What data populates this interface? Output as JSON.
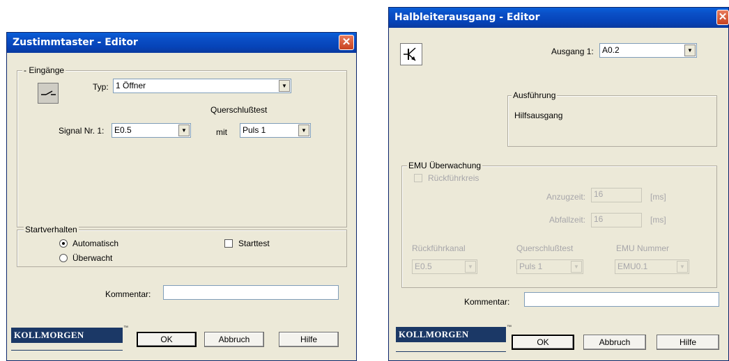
{
  "left_dialog": {
    "title": "Zustimmtaster - Editor",
    "close_glyph": "✕",
    "inputs_group": {
      "legend": "- Eingänge",
      "typ_label": "Typ:",
      "typ_value": "1 Öffner",
      "crossfault_label": "Querschlußtest",
      "signal_label": "Signal Nr. 1:",
      "signal_value": "E0.5",
      "mit_label": "mit",
      "puls_value": "Puls 1"
    },
    "start_group": {
      "legend": "Startverhalten",
      "radio_auto": "Automatisch",
      "radio_monitored": "Überwacht",
      "check_starttest": "Starttest"
    },
    "comment_label": "Kommentar:",
    "comment_value": "",
    "logo": "KOLLMORGEN",
    "buttons": {
      "ok": "OK",
      "cancel": "Abbruch",
      "help": "Hilfe"
    }
  },
  "right_dialog": {
    "title": "Halbleiterausgang - Editor",
    "close_glyph": "✕",
    "output_label": "Ausgang 1:",
    "output_value": "A0.2",
    "exec_group": {
      "legend": "Ausführung",
      "value": "Hilfsausgang"
    },
    "emu_group": {
      "legend": "EMU Überwachung",
      "check_feedback": "Rückführkreis",
      "pickup_label": "Anzugzeit:",
      "pickup_value": "16",
      "dropout_label": "Abfallzeit:",
      "dropout_value": "16",
      "unit_ms": "[ms]",
      "feedback_channel_label": "Rückführkanal",
      "feedback_channel_value": "E0.5",
      "crossfault_label": "Querschlußtest",
      "crossfault_value": "Puls 1",
      "emu_number_label": "EMU Nummer",
      "emu_number_value": "EMU0.1"
    },
    "comment_label": "Kommentar:",
    "comment_value": "",
    "logo": "KOLLMORGEN",
    "buttons": {
      "ok": "OK",
      "cancel": "Abbruch",
      "help": "Hilfe"
    }
  },
  "arrow_glyph": "▼",
  "trademark": "™"
}
